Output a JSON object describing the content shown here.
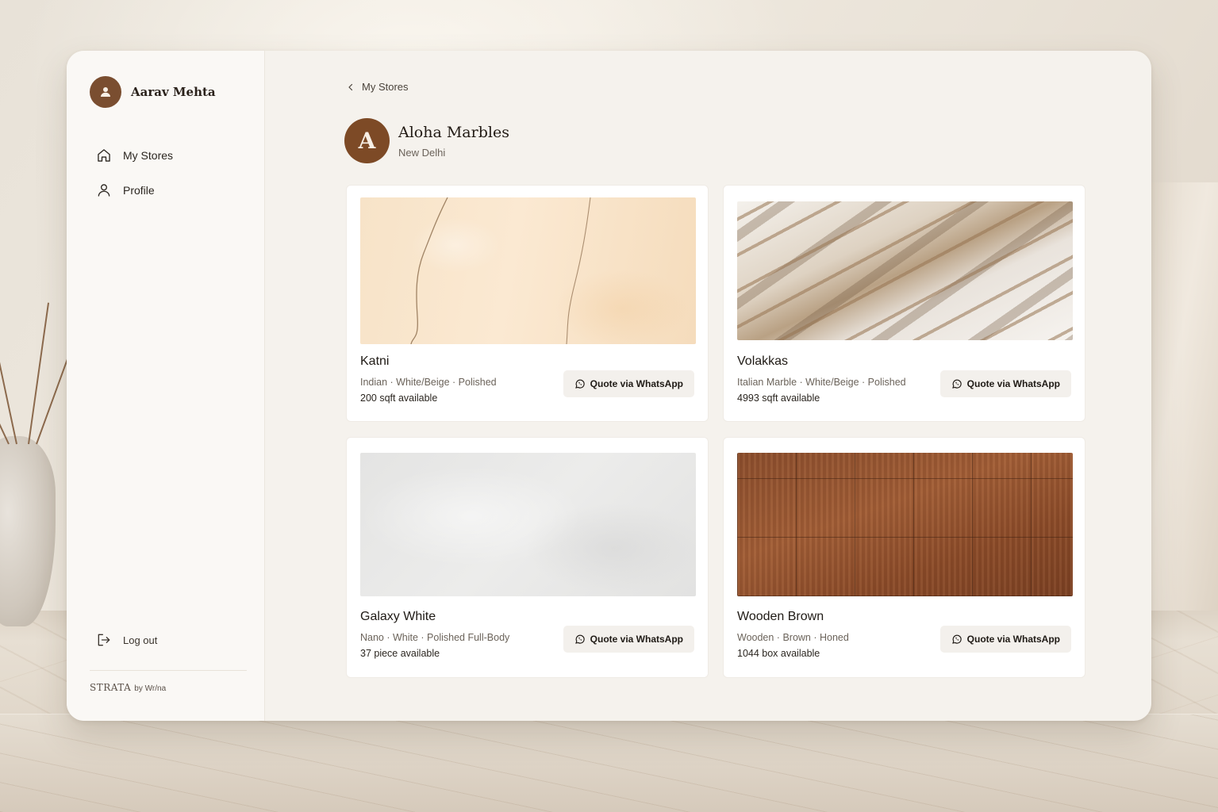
{
  "sidebar": {
    "user_name": "Aarav Mehta",
    "nav": [
      {
        "label": "My Stores",
        "icon": "home-icon"
      },
      {
        "label": "Profile",
        "icon": "user-icon"
      }
    ],
    "logout_label": "Log out",
    "brand_name": "STRATA",
    "brand_by": "by Wr/na"
  },
  "main": {
    "back_label": "My Stores",
    "store": {
      "initial": "A",
      "name": "Aloha Marbles",
      "city": "New Delhi"
    },
    "products": [
      {
        "name": "Katni",
        "meta": "Indian · White/Beige · Polished",
        "stock": "200 sqft available",
        "button": "Quote via WhatsApp",
        "texture": "beige-marble"
      },
      {
        "name": "Volakkas",
        "meta": "Italian Marble · White/Beige · Polished",
        "stock": "4993 sqft available",
        "button": "Quote via WhatsApp",
        "texture": "veined-marble"
      },
      {
        "name": "Galaxy White",
        "meta": "Nano · White · Polished Full-Body",
        "stock": "37 piece available",
        "button": "Quote via WhatsApp",
        "texture": "white-stone"
      },
      {
        "name": "Wooden Brown",
        "meta": "Wooden · Brown · Honed",
        "stock": "1044 box available",
        "button": "Quote via WhatsApp",
        "texture": "wood-tile"
      }
    ]
  },
  "colors": {
    "accent_brown": "#7d4a26",
    "window_bg": "#f5f2ed",
    "sidebar_bg": "#faf8f5"
  }
}
